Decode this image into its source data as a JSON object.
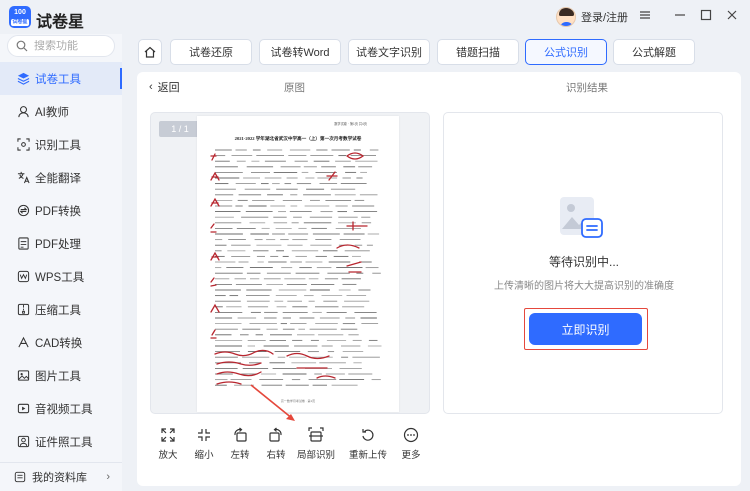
{
  "app": {
    "logo_top": "100",
    "logo_sub": "试卷星",
    "title": "试卷星",
    "login_label": "登录/注册",
    "window_controls": [
      "menu-icon",
      "minimize-icon",
      "maximize-icon",
      "close-icon"
    ]
  },
  "sidebar": {
    "search_placeholder": "搜索功能",
    "items": [
      {
        "label": "试卷工具",
        "icon": "layers-icon",
        "active": true
      },
      {
        "label": "AI教师",
        "icon": "ai-teacher-icon",
        "active": false
      },
      {
        "label": "识别工具",
        "icon": "scan-icon",
        "active": false
      },
      {
        "label": "全能翻译",
        "icon": "translate-icon",
        "active": false
      },
      {
        "label": "PDF转换",
        "icon": "pdf-convert-icon",
        "active": false
      },
      {
        "label": "PDF处理",
        "icon": "pdf-process-icon",
        "active": false
      },
      {
        "label": "WPS工具",
        "icon": "wps-icon",
        "active": false
      },
      {
        "label": "压缩工具",
        "icon": "compress-icon",
        "active": false
      },
      {
        "label": "CAD转换",
        "icon": "cad-icon",
        "active": false
      },
      {
        "label": "图片工具",
        "icon": "image-icon",
        "active": false
      },
      {
        "label": "音视频工具",
        "icon": "media-icon",
        "active": false
      },
      {
        "label": "证件照工具",
        "icon": "id-photo-icon",
        "active": false
      }
    ],
    "bottom_label": "我的资料库",
    "accent": "#2f6bff"
  },
  "tabs": [
    {
      "label": "试卷还原",
      "active": false
    },
    {
      "label": "试卷转Word",
      "active": false
    },
    {
      "label": "试卷文字识别",
      "active": false
    },
    {
      "label": "错题扫描",
      "active": false
    },
    {
      "label": "公式识别",
      "active": true
    },
    {
      "label": "公式解题",
      "active": false
    }
  ],
  "main": {
    "back_label": "返回",
    "original_label": "原图",
    "result_label": "识别结果",
    "page_indicator": "1 / 1",
    "paper_heading": "2021-2022 学年湖北省武汉中学高一（上）第一次月考数学试卷",
    "paper_header_right": "数学试卷 · 第1页 共4页",
    "paper_footer": "高一数学月考试卷 · 第1页",
    "waiting_title": "等待识别中...",
    "waiting_hint": "上传清晰的图片将大大提高识别的准确度",
    "start_button": "立即识别"
  },
  "toolbar": [
    {
      "label": "放大",
      "icon": "zoom-in-icon"
    },
    {
      "label": "缩小",
      "icon": "zoom-out-icon"
    },
    {
      "label": "左转",
      "icon": "rotate-left-icon"
    },
    {
      "label": "右转",
      "icon": "rotate-right-icon"
    },
    {
      "label": "局部识别",
      "icon": "partial-recognize-icon"
    },
    {
      "label": "重新上传",
      "icon": "reupload-icon"
    },
    {
      "label": "更多",
      "icon": "more-icon"
    }
  ],
  "colors": {
    "accent": "#2f6bff",
    "highlight": "#e5483c",
    "handwriting": "#b8262f"
  }
}
